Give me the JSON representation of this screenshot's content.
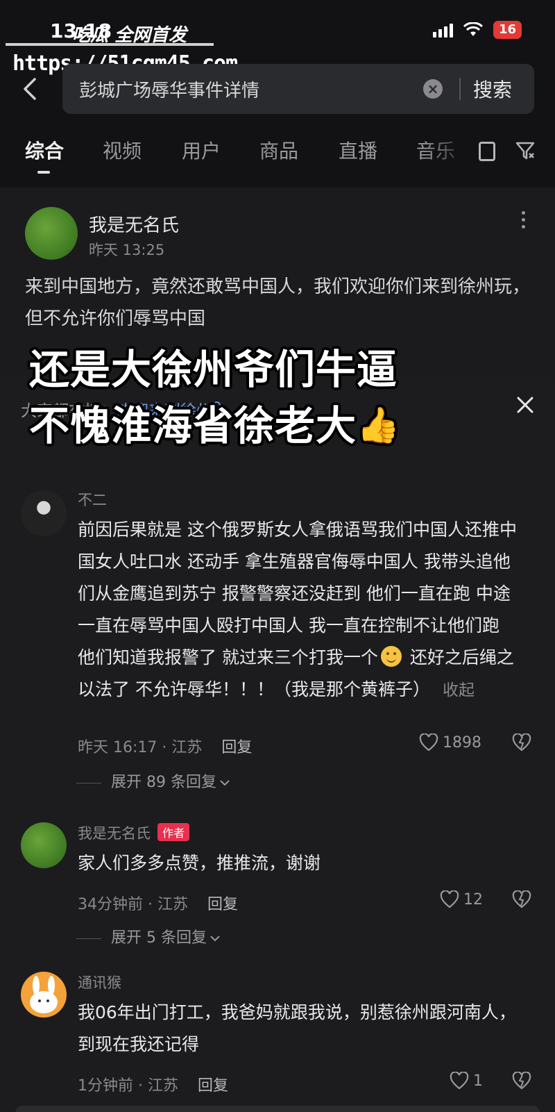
{
  "status_bar": {
    "time": "13:18",
    "battery": "16"
  },
  "watermark": {
    "title": "吃瓜 全网首发",
    "url": "https://51cgm45.com"
  },
  "search": {
    "query": "彭城广场辱华事件详情",
    "button": "搜索",
    "clear_icon": "clear-icon",
    "back_icon": "back-arrow-icon"
  },
  "tabs": [
    "综合",
    "视频",
    "用户",
    "商品",
    "直播",
    "音乐"
  ],
  "post": {
    "author": "我是无名氏",
    "time": "昨天 13:25",
    "text": "来到中国地方，竟然还敢骂中国人，我们欢迎你们来到徐州玩，但不允许你们辱骂中国"
  },
  "overlay_caption": {
    "line1": "还是大徐州爷们牛逼",
    "line2": "不愧淮海省徐老大",
    "emoji": "👍"
  },
  "comments_panel": {
    "trending_prefix": "大家都在搜：",
    "trending_query": "欢迎来到徐州",
    "comments": [
      {
        "user": "不二",
        "text_part1": "前因后果就是 这个俄罗斯女人拿俄语骂我们中国人还推中国女人吐口水 还动手 拿生殖器官侮辱中国人 我带头追他们从金鹰追到苏宁 报警警察还没赶到 他们一直在跑 中途一直在辱骂中国人殴打中国人 我一直在控制不让他们跑 他们知道我报警了 就过来三个打我一个",
        "text_part2": " 还好之后绳之以法了 不允许辱华！！！（我是那个黄裤子）",
        "collapse": "收起",
        "meta": "昨天 16:17 · 江苏",
        "reply": "回复",
        "likes": "1898",
        "expand": "展开 89 条回复"
      },
      {
        "user": "我是无名氏",
        "badge": "作者",
        "text": "家人们多多点赞，推推流，谢谢",
        "meta": "34分钟前 · 江苏",
        "reply": "回复",
        "likes": "12",
        "expand": "展开 5 条回复"
      },
      {
        "user": "通讯猴",
        "text": "我06年出门打工，我爸妈就跟我说，别惹徐州跟河南人，到现在我还记得",
        "meta": "1分钟前 · 江苏",
        "reply": "回复",
        "likes": "1"
      }
    ]
  },
  "colors": {
    "background": "#1c1c1e",
    "link": "#6f9ee8",
    "author_badge": "#e8304f",
    "battery": "#e53935"
  }
}
